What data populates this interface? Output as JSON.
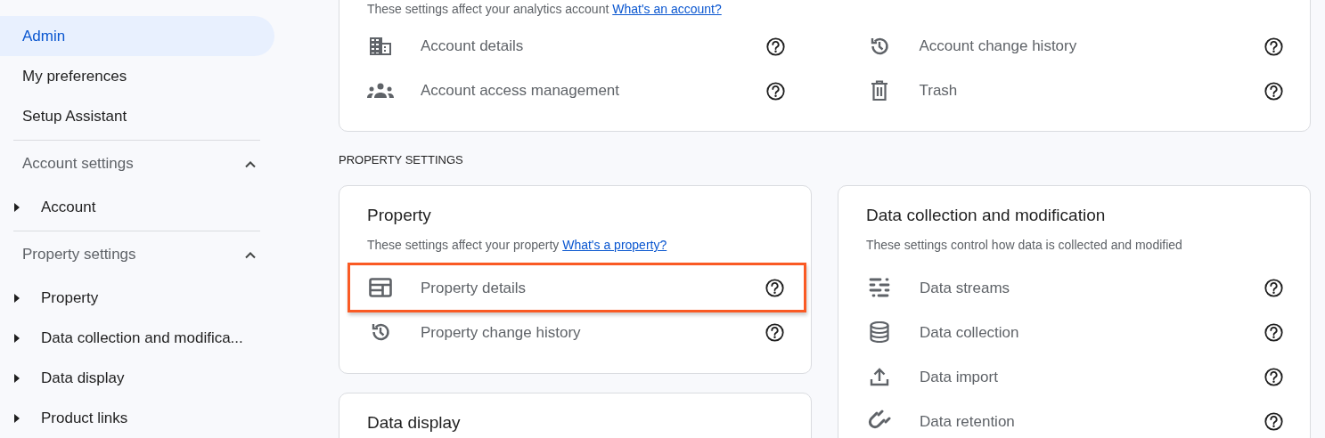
{
  "sidebar": {
    "items": [
      {
        "label": "Admin",
        "selected": true
      },
      {
        "label": "My preferences",
        "selected": false
      },
      {
        "label": "Setup Assistant",
        "selected": false
      }
    ],
    "sections": [
      {
        "title": "Account settings",
        "expanded": true,
        "items": [
          {
            "label": "Account",
            "expanded": false
          }
        ]
      },
      {
        "title": "Property settings",
        "expanded": true,
        "items": [
          {
            "label": "Property",
            "expanded": false
          },
          {
            "label": "Data collection and modifica...",
            "expanded": false
          },
          {
            "label": "Data display",
            "expanded": false
          },
          {
            "label": "Product links",
            "expanded": false
          }
        ]
      }
    ]
  },
  "account_card": {
    "description": "These settings affect your analytics account",
    "link": "What's an account?",
    "rows": [
      {
        "label": "Account details",
        "highlighted": false
      },
      {
        "label": "Account change history",
        "highlighted": false
      },
      {
        "label": "Account access management",
        "highlighted": false
      },
      {
        "label": "Trash",
        "highlighted": false
      }
    ]
  },
  "section_heading": "PROPERTY SETTINGS",
  "cards": [
    {
      "title": "Property",
      "description": "These settings affect your property",
      "link": "What's a property?",
      "rows": [
        {
          "label": "Property details",
          "highlighted": true
        },
        {
          "label": "Property change history",
          "highlighted": false
        }
      ]
    },
    {
      "title": "Data display"
    },
    {
      "title": "Data collection and modification",
      "description": "These settings control how data is collected and modified",
      "rows": [
        {
          "label": "Data streams",
          "highlighted": false
        },
        {
          "label": "Data collection",
          "highlighted": false
        },
        {
          "label": "Data import",
          "highlighted": false
        },
        {
          "label": "Data retention",
          "highlighted": false
        }
      ]
    }
  ]
}
